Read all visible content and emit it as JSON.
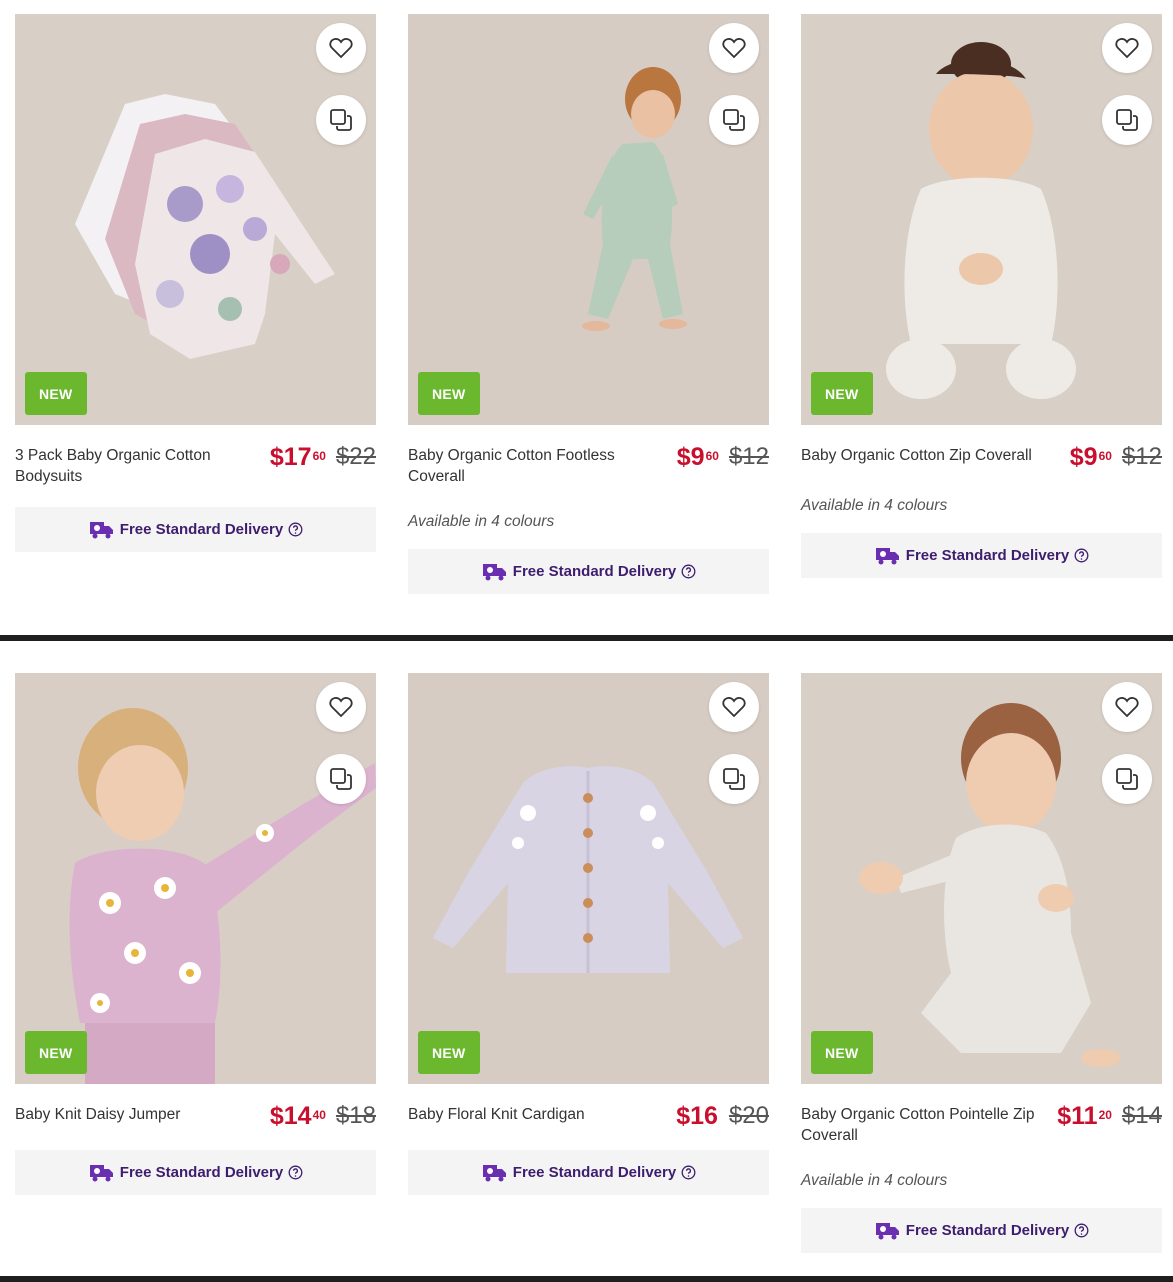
{
  "products": [
    {
      "title": "3 Pack Baby Organic Cotton Bodysuits",
      "badge": "NEW",
      "price_dollars": "$17",
      "price_cents": "60",
      "was_price": "$22",
      "colours": "",
      "delivery_label": "Free Standard Delivery",
      "image_subject": "bodysuits"
    },
    {
      "title": "Baby Organic Cotton Footless Coverall",
      "badge": "NEW",
      "price_dollars": "$9",
      "price_cents": "60",
      "was_price": "$12",
      "colours": "Available in 4 colours",
      "delivery_label": "Free Standard Delivery",
      "image_subject": "toddler-green-coverall"
    },
    {
      "title": "Baby Organic Cotton Zip Coverall",
      "badge": "NEW",
      "price_dollars": "$9",
      "price_cents": "60",
      "was_price": "$12",
      "colours": "Available in 4 colours",
      "delivery_label": "Free Standard Delivery",
      "image_subject": "baby-sitting-white-coverall"
    },
    {
      "title": "Baby Knit Daisy Jumper",
      "badge": "NEW",
      "price_dollars": "$14",
      "price_cents": "40",
      "was_price": "$18",
      "colours": "",
      "delivery_label": "Free Standard Delivery",
      "image_subject": "toddler-daisy-jumper"
    },
    {
      "title": "Baby Floral Knit Cardigan",
      "badge": "NEW",
      "price_dollars": "$16",
      "price_cents": "",
      "was_price": "$20",
      "colours": "",
      "delivery_label": "Free Standard Delivery",
      "image_subject": "lilac-cardigan"
    },
    {
      "title": "Baby Organic Cotton Pointelle Zip Coverall",
      "badge": "NEW",
      "price_dollars": "$11",
      "price_cents": "20",
      "was_price": "$14",
      "colours": "Available in 4 colours",
      "delivery_label": "Free Standard Delivery",
      "image_subject": "baby-crawling-pointelle-coverall"
    }
  ],
  "icons": {
    "wishlist": "heart-icon",
    "compare": "compare-icon",
    "delivery": "truck-icon",
    "help": "question-icon"
  },
  "colors": {
    "sale_price": "#c8102e",
    "new_badge": "#6bb82f",
    "delivery_text": "#3e1d6e",
    "image_background": "#d9d0c7"
  }
}
